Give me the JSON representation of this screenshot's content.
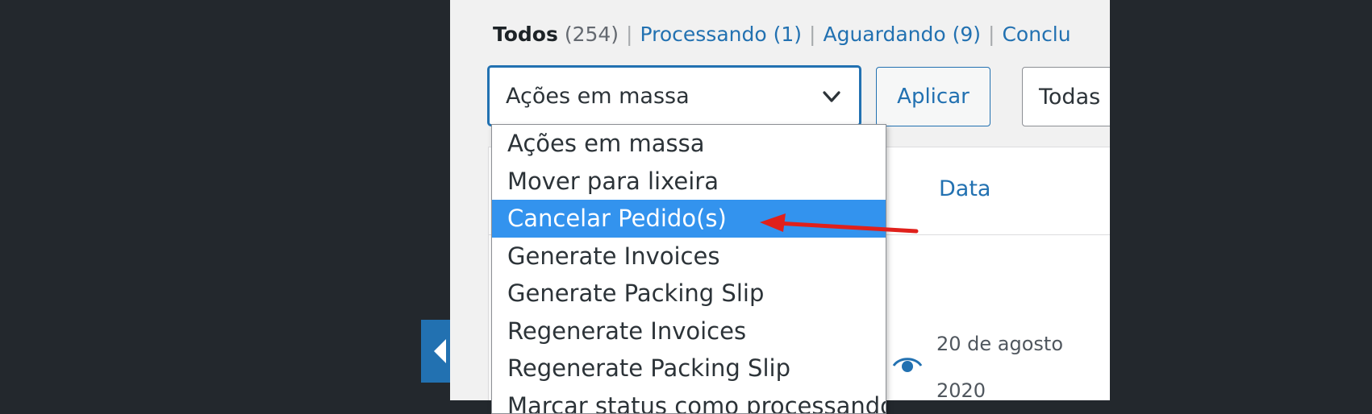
{
  "status_links": {
    "all_label": "Todos",
    "all_count": "(254)",
    "processing_label": "Processando",
    "processing_count": "(1)",
    "waiting_label": "Aguardando",
    "waiting_count": "(9)",
    "completed_partial": "Conclu",
    "separator": "|"
  },
  "bulk_actions": {
    "selected": "Ações em massa",
    "apply_label": "Aplicar",
    "options": [
      "Ações em massa",
      "Mover para lixeira",
      "Cancelar Pedido(s)",
      "Generate Invoices",
      "Generate Packing Slip",
      "Regenerate Invoices",
      "Regenerate Packing Slip",
      "Marcar status como processando"
    ],
    "highlighted_index": 2
  },
  "date_filter": {
    "selected": "Todas"
  },
  "table": {
    "column_date": "Data",
    "row_date_line1": "20 de agosto",
    "row_date_line2": "2020"
  },
  "colors": {
    "accent": "#2271b1",
    "highlight": "#3393ee",
    "annotation_arrow": "#e0201b",
    "admin_dark": "#23282d"
  },
  "icons": {
    "select_chevron": "chevron-down-icon",
    "preview": "eye-icon",
    "collapse": "collapse-arrow-icon",
    "annotation": "red-arrow-icon"
  }
}
